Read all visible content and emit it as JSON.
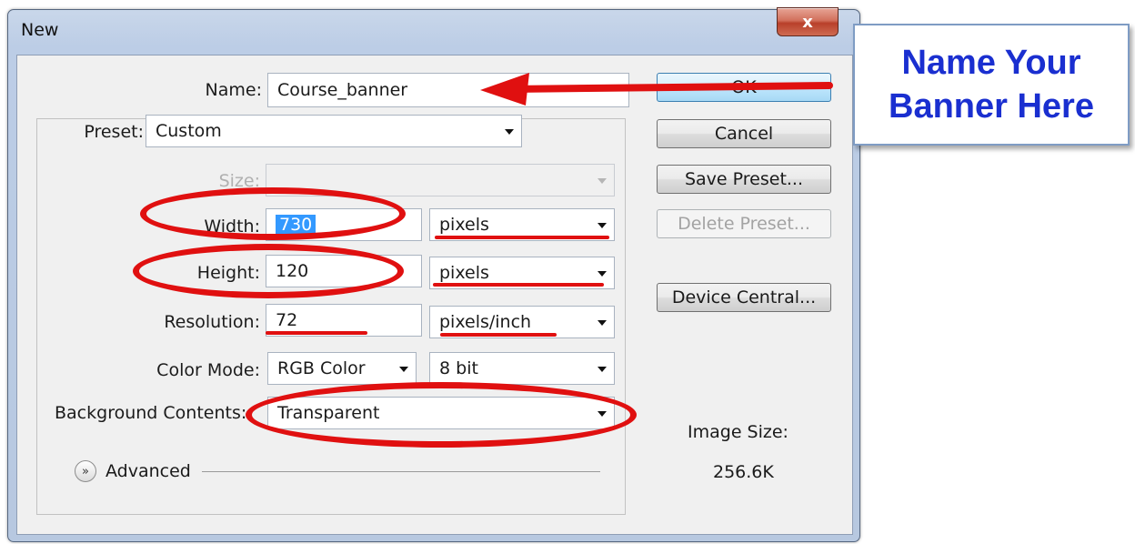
{
  "window": {
    "title": "New",
    "close_label": "x"
  },
  "form": {
    "name": {
      "label": "Name:",
      "value": "Course_banner"
    },
    "preset": {
      "label": "Preset:",
      "value": "Custom"
    },
    "size": {
      "label": "Size:",
      "value": ""
    },
    "width": {
      "label": "Width:",
      "value": "730",
      "unit": "pixels"
    },
    "height": {
      "label": "Height:",
      "value": "120",
      "unit": "pixels"
    },
    "resolution": {
      "label": "Resolution:",
      "value": "72",
      "unit": "pixels/inch"
    },
    "color_mode": {
      "label": "Color Mode:",
      "value": "RGB Color",
      "depth": "8 bit"
    },
    "background": {
      "label": "Background Contents:",
      "value": "Transparent"
    },
    "advanced": {
      "label": "Advanced",
      "icon": "double-chevron-down-icon"
    }
  },
  "buttons": {
    "ok": "OK",
    "cancel": "Cancel",
    "save_preset": "Save Preset...",
    "delete_preset": "Delete Preset...",
    "device_central": "Device Central..."
  },
  "image_size": {
    "label": "Image Size:",
    "value": "256.6K"
  },
  "callout": {
    "line1": "Name Your",
    "line2": "Banner Here"
  },
  "colors": {
    "annotation_red": "#e01010",
    "callout_text": "#1a2fd0",
    "selection": "#3399ff"
  }
}
